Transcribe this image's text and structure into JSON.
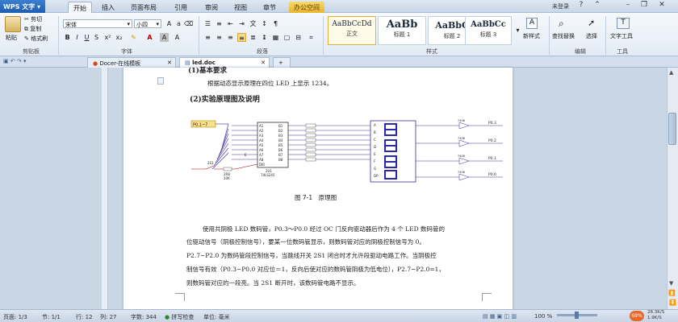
{
  "app": {
    "name": "WPS 文字",
    "login": "未登录"
  },
  "menu": [
    "开始",
    "插入",
    "页面布局",
    "引用",
    "审阅",
    "视图",
    "章节",
    "办公空间"
  ],
  "ribbon": {
    "paste": "粘贴",
    "cut": "剪切",
    "copy": "复制",
    "format_painter": "格式刷",
    "font_name": "宋体",
    "font_size": "小四",
    "groups": {
      "clipboard": "剪贴板",
      "font": "字体",
      "paragraph": "段落",
      "styles": "样式",
      "edit": "编辑",
      "tools": "工具"
    },
    "styles": [
      {
        "sample": "AaBbCcDd",
        "name": "正文"
      },
      {
        "sample": "AaBb",
        "name": "标题 1"
      },
      {
        "sample": "AaBbC",
        "name": "标题 2"
      },
      {
        "sample": "AaBbCc",
        "name": "标题 3"
      }
    ],
    "new_style": "新样式",
    "find_replace": "查找替换",
    "select": "选择",
    "text_tools": "文字工具"
  },
  "doc_tabs": [
    "Docer-在线模板",
    "led.doc"
  ],
  "page": {
    "partial_heading": "(1)基本要求",
    "req_line": "根据动态显示原理在四位 LED 上显示 1234。",
    "heading2": "(2)实验原理图及说明",
    "figure_caption": "图 7-1　原理图",
    "body": [
      "使用共阴极 LED 数码管，P0.3～P0.0 经过 OC 门反向驱动器后作为 4 个 LED 数码管的",
      "位驱动信号（阴极控制信号），要某一位数码管显示，则数码管对应的阴极控制信号为 0。",
      "P2.7~P2.0 为数码管段控制信号，当跳线开关 2S1 闭合时才允许段驱动电路工作。当阴极控",
      "制信号有效（P0.3~P0.0 对应位＝1，反向后使对应的数码管阴极为低电位），P2.7~P2.0=1，",
      "则数码管对应的一段亮。当 2S1 断开时，该数码管电路不显示。"
    ]
  },
  "schematic": {
    "p0_label": "P0.1~7",
    "chip_label": "74LS245",
    "chip_id": "2U1",
    "pins_left": [
      "A1",
      "A2",
      "A3",
      "A4",
      "A5",
      "A6",
      "A7",
      "A8"
    ],
    "pins_right": [
      "B1",
      "B2",
      "B3",
      "B4",
      "B5",
      "B6",
      "B7",
      "B8"
    ],
    "seg_letters": [
      "A",
      "B",
      "C",
      "D",
      "E",
      "F",
      "G",
      "DP"
    ],
    "outputs": [
      "P0.3",
      "P0.2",
      "P0.1",
      "P0.0"
    ],
    "gate_label": "7406",
    "switch_label": "2S1",
    "res_labels": [
      "2R8",
      "10K"
    ],
    "dir_label": "DIR",
    "e_label": "E"
  },
  "status": {
    "page": "页面: 1/3",
    "section": "节: 1/1",
    "line": "行: 12",
    "col": "列: 27",
    "words": "字数: 344",
    "spell": "拼写检查",
    "unit": "单位: 毫米",
    "zoom": "100 %",
    "badge": "69%",
    "net_up": "28.3K/S",
    "net_down": "1.9K/S"
  }
}
